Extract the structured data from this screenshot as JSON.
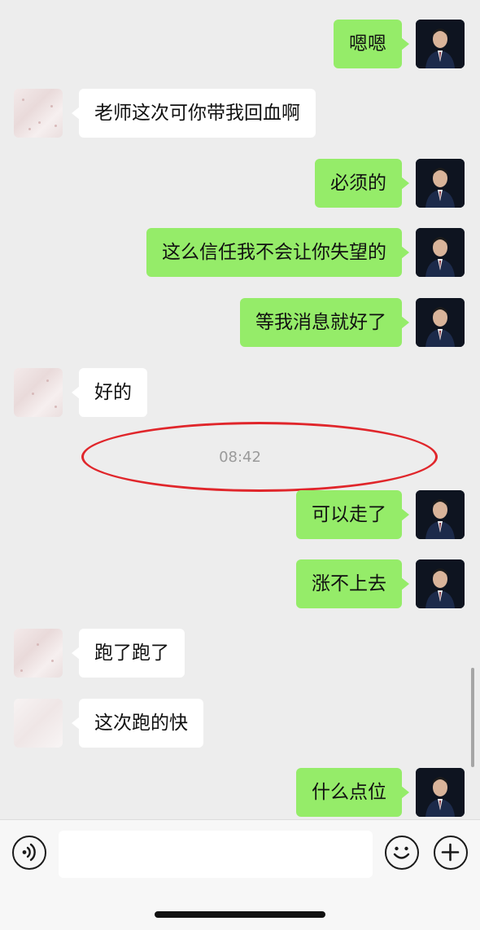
{
  "messages": [
    {
      "side": "self",
      "text": "嗯嗯"
    },
    {
      "side": "other",
      "text": "老师这次可你带我回血啊"
    },
    {
      "side": "self",
      "text": "必须的"
    },
    {
      "side": "self",
      "text": "这么信任我不会让你失望的"
    },
    {
      "side": "self",
      "text": "等我消息就好了"
    },
    {
      "side": "other",
      "text": "好的"
    },
    {
      "side": "self",
      "text": "可以走了"
    },
    {
      "side": "self",
      "text": "涨不上去"
    },
    {
      "side": "other",
      "text": "跑了跑了"
    },
    {
      "side": "other",
      "text": "这次跑的快"
    },
    {
      "side": "self",
      "text": "什么点位"
    }
  ],
  "timestamp": "08:42",
  "input": {
    "value": "",
    "placeholder": ""
  },
  "icons": {
    "voice": "voice-wave-icon",
    "emoji": "smiley-icon",
    "plus": "plus-icon"
  },
  "colors": {
    "self_bubble": "#95ec69",
    "other_bubble": "#ffffff",
    "background": "#ededed",
    "highlight": "#e0262b"
  }
}
